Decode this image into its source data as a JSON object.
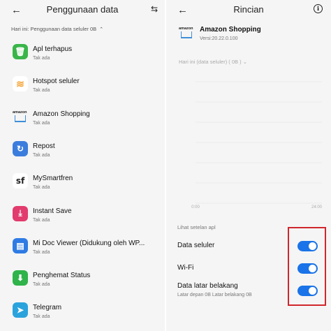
{
  "left": {
    "title": "Penggunaan data",
    "back_glyph": "←",
    "sort_glyph": "⇆",
    "filter_label": "Hari ini: Penggunaan data seluler 0B",
    "filter_chevron": "⌃",
    "apps": [
      {
        "name": "Apl terhapus",
        "status": "Tak ada",
        "icon": "trash-icon",
        "color": "#3ab54a"
      },
      {
        "name": "Hotspot seluler",
        "status": "Tak ada",
        "icon": "wifi-hotspot-icon",
        "color": "#f4a63a"
      },
      {
        "name": "Amazon Shopping",
        "status": "Tak ada",
        "icon": "amazon-icon",
        "color": "#ffffff"
      },
      {
        "name": "Repost",
        "status": "Tak ada",
        "icon": "repost-icon",
        "color": "#3b7ddd"
      },
      {
        "name": "MySmartfren",
        "status": "Tak ada",
        "icon": "smartfren-icon",
        "color": "#ffffff"
      },
      {
        "name": "Instant Save",
        "status": "Tak ada",
        "icon": "instant-save-icon",
        "color": "#e23b6d"
      },
      {
        "name": "Mi Doc Viewer (Didukung oleh WP...",
        "status": "Tak ada",
        "icon": "doc-viewer-icon",
        "color": "#2f7be4"
      },
      {
        "name": "Penghemat Status",
        "status": "Tak ada",
        "icon": "status-saver-icon",
        "color": "#2fb34a"
      },
      {
        "name": "Telegram",
        "status": "Tak ada",
        "icon": "telegram-icon",
        "color": "#2aa3dd"
      }
    ]
  },
  "right": {
    "title": "Rincian",
    "back_glyph": "←",
    "info_glyph": "i",
    "app_name": "Amazon Shopping",
    "app_version": "Versi:20.22.0.100",
    "dropdown_label": "Hari ini (data seluler)",
    "dropdown_value": "0B",
    "section_label": "Lihat setelan apl",
    "settings": [
      {
        "label": "Data seluler",
        "enabled": true
      },
      {
        "label": "Wi-Fi",
        "enabled": true
      },
      {
        "label": "Data latar belakang",
        "enabled": true
      }
    ],
    "background_usage": "Latar depan 0B  Latar belakang 0B",
    "accent_color": "#1a73e8",
    "highlight_color": "#d0262d"
  },
  "chart_data": {
    "type": "bar",
    "title": "",
    "xlabel": "",
    "ylabel": "",
    "x_ticks": [
      "0:00",
      "24:00"
    ],
    "values": [],
    "grid": true
  }
}
